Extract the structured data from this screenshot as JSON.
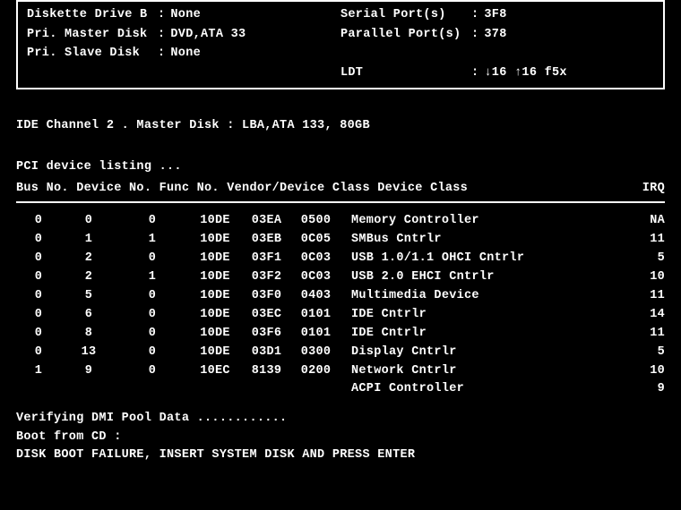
{
  "sys_info": {
    "left": [
      {
        "label": "Diskette Drive B",
        "value": "None"
      },
      {
        "label": "Pri. Master Disk",
        "value": "DVD,ATA 33"
      },
      {
        "label": "Pri. Slave  Disk",
        "value": "None"
      }
    ],
    "right": [
      {
        "label": "Serial Port(s)",
        "value": "3F8"
      },
      {
        "label": "Parallel Port(s)",
        "value": "378"
      },
      {
        "label": "",
        "value": ""
      },
      {
        "label": "LDT",
        "value": "↓16 ↑16 f5x"
      }
    ]
  },
  "ide_line": "IDE Channel 2 . Master Disk  :  LBA,ATA 133,   80GB",
  "pci": {
    "title": "PCI device listing ...",
    "header": "Bus No. Device No. Func No. Vendor/Device Class Device Class",
    "irq_header": "IRQ",
    "rows": [
      {
        "bus": "0",
        "dev": "0",
        "func": "0",
        "vendor": "10DE",
        "device": "03EA",
        "class": "0500",
        "desc": "Memory Controller",
        "irq": "NA"
      },
      {
        "bus": "0",
        "dev": "1",
        "func": "1",
        "vendor": "10DE",
        "device": "03EB",
        "class": "0C05",
        "desc": "SMBus Cntrlr",
        "irq": "11"
      },
      {
        "bus": "0",
        "dev": "2",
        "func": "0",
        "vendor": "10DE",
        "device": "03F1",
        "class": "0C03",
        "desc": "USB 1.0/1.1 OHCI Cntrlr",
        "irq": "5"
      },
      {
        "bus": "0",
        "dev": "2",
        "func": "1",
        "vendor": "10DE",
        "device": "03F2",
        "class": "0C03",
        "desc": "USB 2.0 EHCI Cntrlr",
        "irq": "10"
      },
      {
        "bus": "0",
        "dev": "5",
        "func": "0",
        "vendor": "10DE",
        "device": "03F0",
        "class": "0403",
        "desc": "Multimedia Device",
        "irq": "11"
      },
      {
        "bus": "0",
        "dev": "6",
        "func": "0",
        "vendor": "10DE",
        "device": "03EC",
        "class": "0101",
        "desc": "IDE Cntrlr",
        "irq": "14"
      },
      {
        "bus": "0",
        "dev": "8",
        "func": "0",
        "vendor": "10DE",
        "device": "03F6",
        "class": "0101",
        "desc": "IDE Cntrlr",
        "irq": "11"
      },
      {
        "bus": "0",
        "dev": "13",
        "func": "0",
        "vendor": "10DE",
        "device": "03D1",
        "class": "0300",
        "desc": "Display Cntrlr",
        "irq": "5"
      },
      {
        "bus": "1",
        "dev": "9",
        "func": "0",
        "vendor": "10EC",
        "device": "8139",
        "class": "0200",
        "desc": "Network Cntrlr",
        "irq": "10"
      },
      {
        "bus": "",
        "dev": "",
        "func": "",
        "vendor": "",
        "device": "",
        "class": "",
        "desc": "ACPI Controller",
        "irq": "9"
      }
    ]
  },
  "boot": {
    "verify": "Verifying DMI Pool Data ............",
    "cd": "Boot from CD :",
    "failure": "DISK BOOT FAILURE, INSERT SYSTEM DISK AND PRESS ENTER"
  }
}
